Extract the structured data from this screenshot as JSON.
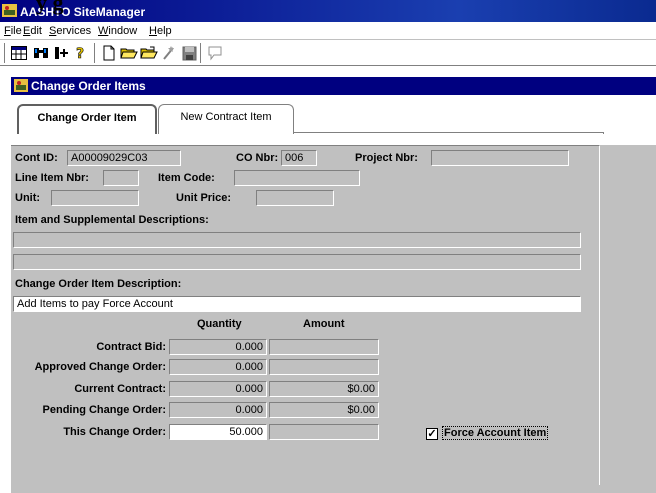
{
  "app": {
    "overlay_heading": "y g",
    "title": "AASHTO SiteManager"
  },
  "menu": [
    "File",
    "Edit",
    "Services",
    "Window",
    "Help"
  ],
  "toolbar": {
    "icons": [
      "grid-icon",
      "binoculars-icon",
      "insert-icon",
      "help-icon",
      "new-document-icon",
      "open-folder-icon",
      "open-folder-icon",
      "wizard-icon",
      "save-icon",
      "comment-icon"
    ]
  },
  "window": {
    "title": "Change Order Items",
    "tabs": [
      {
        "label": "Change Order Item",
        "active": true
      },
      {
        "label": "New Contract Item",
        "active": false
      }
    ]
  },
  "form": {
    "cont_id_label": "Cont ID:",
    "cont_id_value": "A00009029C03",
    "co_nbr_label": "CO Nbr:",
    "co_nbr_value": "006",
    "project_nbr_label": "Project Nbr:",
    "project_nbr_value": "",
    "line_item_label": "Line Item Nbr:",
    "line_item_value": "",
    "item_code_label": "Item Code:",
    "item_code_value": "",
    "unit_label": "Unit:",
    "unit_value": "",
    "unit_price_label": "Unit Price:",
    "unit_price_value": "",
    "supp_desc_label": "Item and Supplemental Descriptions:",
    "supp_desc_line1": "",
    "supp_desc_line2": "",
    "co_item_desc_label": "Change Order Item Description:",
    "co_item_desc_value": "Add Items to pay Force Account",
    "col_quantity": "Quantity",
    "col_amount": "Amount",
    "rows": [
      {
        "label": "Contract Bid:",
        "quantity": "0.000",
        "amount": ""
      },
      {
        "label": "Approved Change Order:",
        "quantity": "0.000",
        "amount": ""
      },
      {
        "label": "Current Contract:",
        "quantity": "0.000",
        "amount": "$0.00"
      },
      {
        "label": "Pending Change Order:",
        "quantity": "0.000",
        "amount": "$0.00"
      },
      {
        "label": "This Change Order:",
        "quantity": "50.000",
        "amount": ""
      }
    ],
    "force_account_label": "Force Account Item",
    "force_account_checked": true,
    "checkbox_mark": "✓"
  }
}
